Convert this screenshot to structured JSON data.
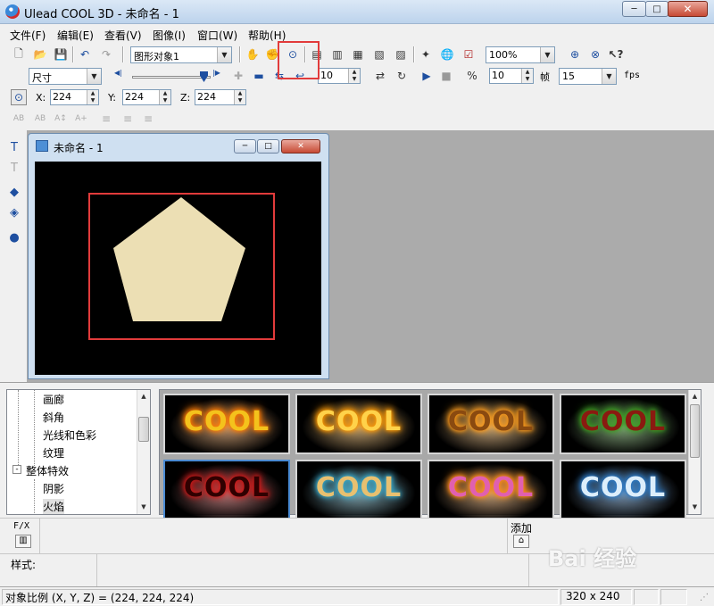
{
  "window": {
    "title": "Ulead COOL 3D - 未命名 - 1",
    "minimize": "─",
    "maximize": "□",
    "close": "✕"
  },
  "menu": [
    "文件(F)",
    "编辑(E)",
    "查看(V)",
    "图像(I)",
    "窗口(W)",
    "帮助(H)"
  ],
  "toolbar1": {
    "object_select": "图形对象1",
    "zoom": "100%"
  },
  "toolbar2": {
    "property_select": "尺寸",
    "frame_value": "10",
    "speed_value": "10",
    "frame_label": "帧",
    "fps_value": "15",
    "fps_label": "fps"
  },
  "toolbar3": {
    "x_label": "X:",
    "x_value": "224",
    "y_label": "Y:",
    "y_value": "224",
    "z_label": "Z:",
    "z_value": "224"
  },
  "document": {
    "title": "未命名 - 1",
    "min": "─",
    "max": "□",
    "close": "✕",
    "pentagon_color": "#ecdfb4"
  },
  "tree": {
    "items": [
      {
        "label": "画廊",
        "level": 2
      },
      {
        "label": "斜角",
        "level": 2
      },
      {
        "label": "光线和色彩",
        "level": 2
      },
      {
        "label": "纹理",
        "level": 2
      },
      {
        "label": "整体特效",
        "level": 1,
        "expander": "-"
      },
      {
        "label": "阴影",
        "level": 2
      },
      {
        "label": "火焰",
        "level": 2
      }
    ]
  },
  "gallery": {
    "thumbs": [
      {
        "text": "COOL",
        "color": "#f4c21c",
        "glow": "#ff7a00"
      },
      {
        "text": "COOL",
        "color": "#ffd24a",
        "glow": "#ff9900"
      },
      {
        "text": "COOL",
        "color": "#8a4a10",
        "glow": "#ff9c1a"
      },
      {
        "text": "COOL",
        "color": "#8a1a10",
        "glow": "#3aa020"
      },
      {
        "text": "COOL",
        "color": "#300000",
        "glow": "#d01818"
      },
      {
        "text": "COOL",
        "color": "#e8c070",
        "glow": "#3aa8c8"
      },
      {
        "text": "COOL",
        "color": "#e060b0",
        "glow": "#ff8c1a"
      },
      {
        "text": "COOL",
        "color": "#dceefb",
        "glow": "#2a7ac8"
      }
    ]
  },
  "fx": {
    "fx_label": "F/X",
    "add_label": "添加"
  },
  "style": {
    "label": "样式:"
  },
  "status": {
    "message": "对象比例 (X, Y, Z) = (224, 224, 224)",
    "size": "320 x 240"
  },
  "watermark": "Bai 经验"
}
